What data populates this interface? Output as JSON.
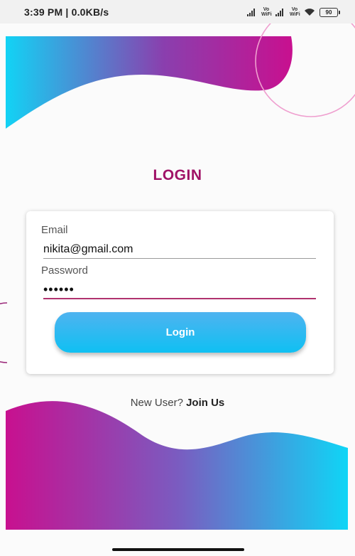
{
  "status_bar": {
    "time": "3:39 PM | 0.0KB/s",
    "volte_1": "Vo WiFi",
    "volte_2": "Vo WiFi",
    "battery": "90"
  },
  "login_screen": {
    "title": "LOGIN",
    "email_label": "Email",
    "email_value": "nikita@gmail.com",
    "password_label": "Password",
    "password_value": "••••••",
    "login_button_label": "Login",
    "new_user_text": "New User?",
    "join_link_text": "Join Us"
  },
  "colors": {
    "accent_magenta": "#a01367",
    "gradient_cyan": "#12d3f5",
    "gradient_purple": "#8a3fae",
    "gradient_pink": "#c8108f",
    "button_blue": "#0fc0f2"
  },
  "icons": [
    "signal-icon",
    "wifi-icon",
    "battery-icon"
  ]
}
